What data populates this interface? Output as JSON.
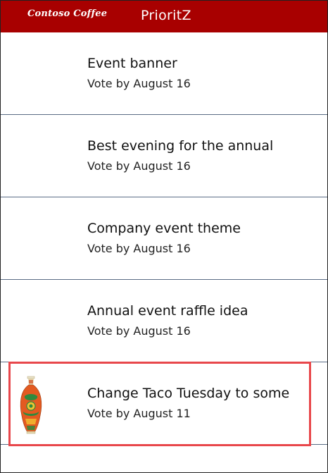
{
  "header": {
    "logo_text": "Contoso Coffee",
    "app_title": "PrioritZ",
    "background_color": "#a80000"
  },
  "list": {
    "items": [
      {
        "title": "Event banner",
        "subtitle": "Vote by August 16",
        "has_image": false
      },
      {
        "title": "Best evening for the annual",
        "subtitle": "Vote by August 16",
        "has_image": false
      },
      {
        "title": "Company event theme",
        "subtitle": "Vote by August 16",
        "has_image": false
      },
      {
        "title": "Annual event raffle idea",
        "subtitle": "Vote by August 16",
        "has_image": false
      },
      {
        "title": "Change Taco Tuesday to some",
        "subtitle": "Vote by August 11",
        "has_image": true,
        "image_icon": "vase-image",
        "selected": true
      }
    ]
  },
  "colors": {
    "divider": "#5a6b84",
    "highlight_border": "#e8474b"
  }
}
